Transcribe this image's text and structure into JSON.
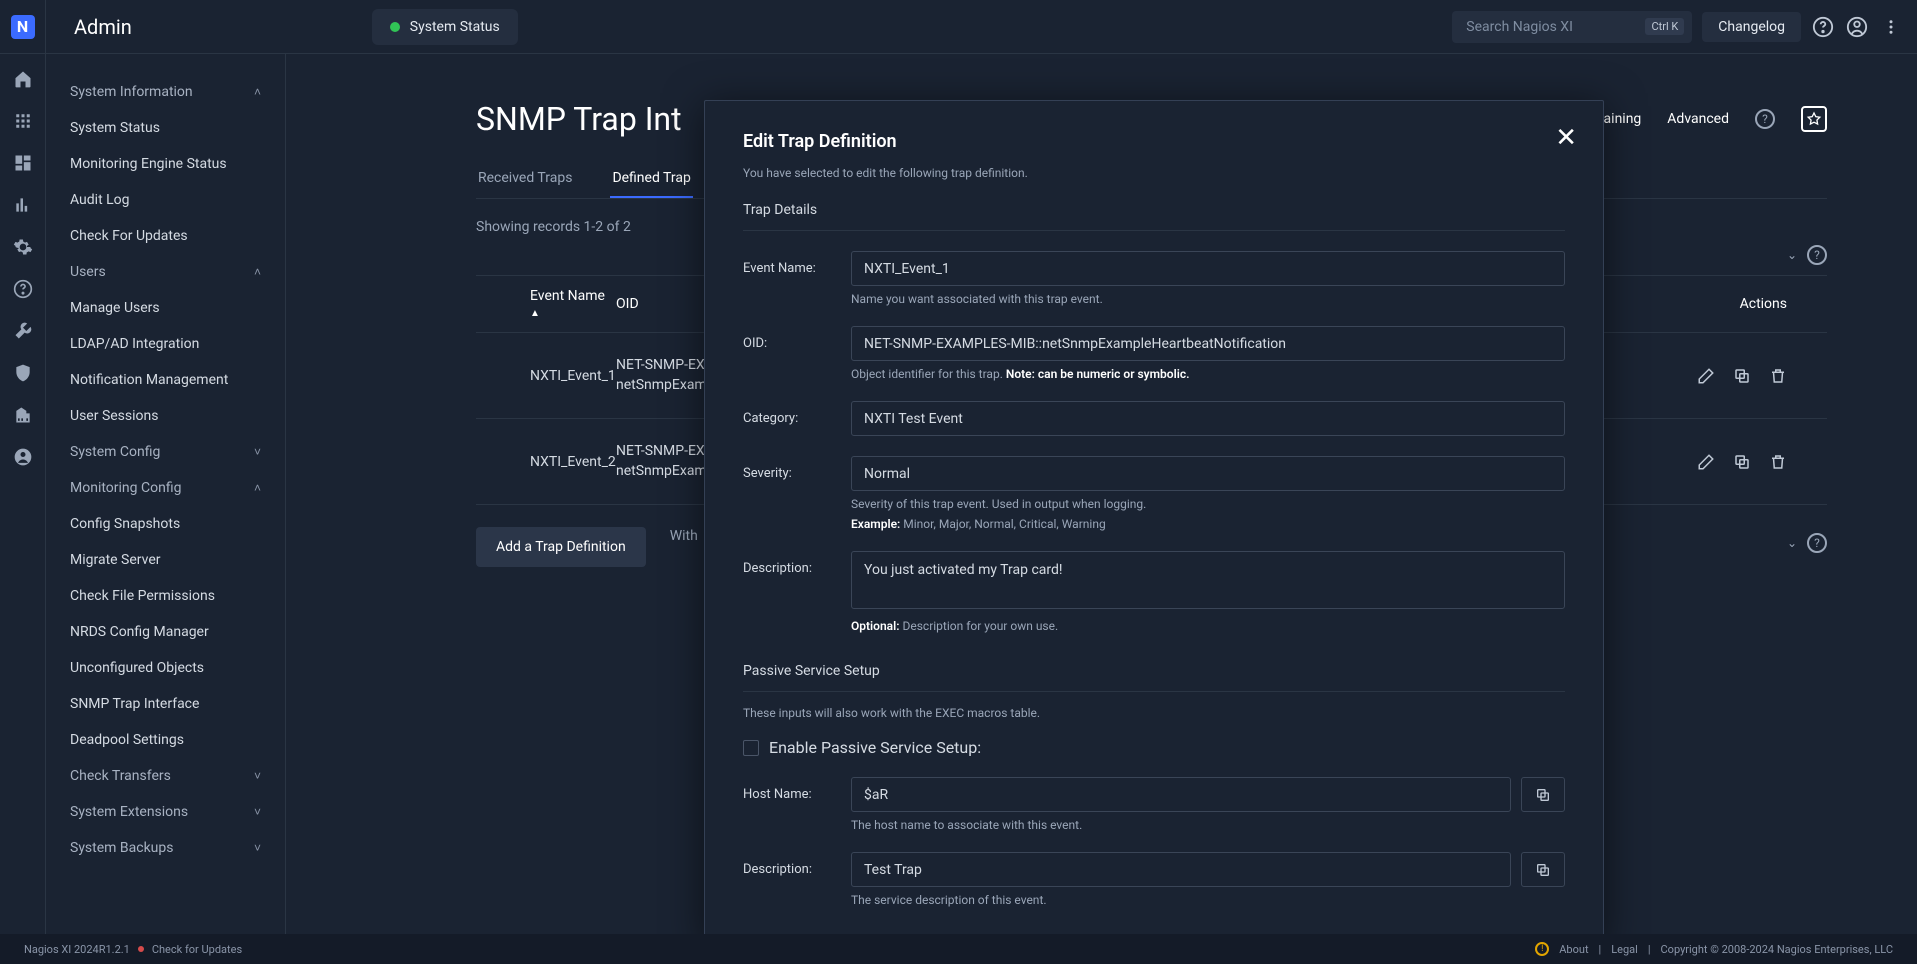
{
  "app": {
    "title": "Admin",
    "status_label": "System Status"
  },
  "top": {
    "search_placeholder": "Search Nagios XI",
    "kbd": "Ctrl K",
    "changelog": "Changelog"
  },
  "sidebar": {
    "groups": [
      {
        "label": "System Information",
        "open": true,
        "items": [
          "System Status",
          "Monitoring Engine Status",
          "Audit Log",
          "Check For Updates"
        ]
      },
      {
        "label": "Users",
        "open": true,
        "items": [
          "Manage Users",
          "LDAP/AD Integration",
          "Notification Management",
          "User Sessions"
        ]
      },
      {
        "label": "System Config",
        "open": false,
        "items": []
      },
      {
        "label": "Monitoring Config",
        "open": true,
        "items": [
          "Config Snapshots",
          "Migrate Server",
          "Check File Permissions",
          "NRDS Config Manager",
          "Unconfigured Objects",
          "SNMP Trap Interface",
          "Deadpool Settings"
        ]
      },
      {
        "label": "Check Transfers",
        "open": false,
        "items": []
      },
      {
        "label": "System Extensions",
        "open": false,
        "items": []
      },
      {
        "label": "System Backups",
        "open": false,
        "items": []
      }
    ]
  },
  "page": {
    "title_partial": "SNMP Trap Int",
    "advanced": "Advanced",
    "training_hint": "is training",
    "tabs": [
      "Received Traps",
      "Defined Trap"
    ],
    "showing": "Showing records 1-2 of 2",
    "columns": {
      "event": "Event Name",
      "oid": "OID",
      "actions": "Actions"
    },
    "rows": [
      {
        "event": "NXTI_Event_1",
        "oid": "NET-SNMP-EXAMPLES-MIB::netSnmpExampleHeartbeatNotification"
      },
      {
        "event": "NXTI_Event_2",
        "oid": "NET-SNMP-EXAMPLES-MIB::netSnmpExampleHeartbeatNotification"
      }
    ],
    "add_btn": "Add a Trap Definition",
    "with_selected": "With"
  },
  "modal": {
    "title": "Edit Trap Definition",
    "intro": "You have selected to edit the following trap definition.",
    "trap_details_h": "Trap Details",
    "event_name": {
      "label": "Event Name:",
      "value": "NXTI_Event_1",
      "hint": "Name you want associated with this trap event."
    },
    "oid": {
      "label": "OID:",
      "value": "NET-SNMP-EXAMPLES-MIB::netSnmpExampleHeartbeatNotification",
      "hint_pre": "Object identifier for this trap. ",
      "hint_bold": "Note: can be numeric or symbolic."
    },
    "category": {
      "label": "Category:",
      "value": "NXTI Test Event"
    },
    "severity": {
      "label": "Severity:",
      "value": "Normal",
      "hint1": "Severity of this trap event. Used in output when logging.",
      "hint2_bold": "Example:",
      "hint2_rest": " Minor, Major, Normal, Critical, Warning"
    },
    "description": {
      "label": "Description:",
      "value": "You just activated my Trap card!",
      "hint_bold": "Optional:",
      "hint_rest": " Description for your own use."
    },
    "pss_h": "Passive Service Setup",
    "pss_intro": "These inputs will also work with the EXEC macros table.",
    "pss_enable": "Enable Passive Service Setup:",
    "host": {
      "label": "Host Name:",
      "value": "$aR",
      "hint": "The host name to associate with this event."
    },
    "svc_desc": {
      "label": "Description:",
      "value": "Test Trap",
      "hint": "The service description of this event."
    }
  },
  "footer": {
    "version": "Nagios XI 2024R1.2.1",
    "check_updates": "Check for Updates",
    "about": "About",
    "legal": "Legal",
    "copyright": "Copyright © 2008-2024 Nagios Enterprises, LLC"
  }
}
